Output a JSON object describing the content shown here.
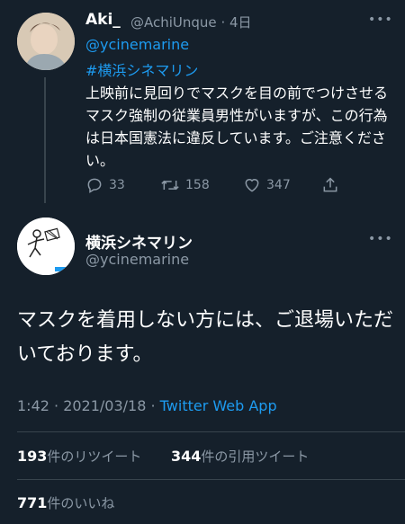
{
  "reply_tweet": {
    "name": "Aki_",
    "handle": "@AchiUnque",
    "time": "4日",
    "mention": "@ycinemarine",
    "hashtag": "#横浜シネマリン",
    "text": "上映前に見回りでマスクを目の前でつけさせるマスク強制の従業員男性がいますが、この行為は日本国憲法に違反しています。ご注意ください。",
    "actions": {
      "replies": "33",
      "retweets": "158",
      "likes": "347"
    }
  },
  "main_tweet": {
    "name": "横浜シネマリン",
    "handle": "@ycinemarine",
    "text": "マスクを着用しない方には、ご退場いただいております。",
    "time": "1:42 · 2021/03/18 ·",
    "source": "Twitter Web App",
    "stats": {
      "retweet_count": "193",
      "retweet_label": "件のリツイート",
      "quote_count": "344",
      "quote_label": "件の引用ツイート",
      "like_count": "771",
      "like_label": "件のいいね"
    }
  },
  "more_icon": "more-dots-icon"
}
